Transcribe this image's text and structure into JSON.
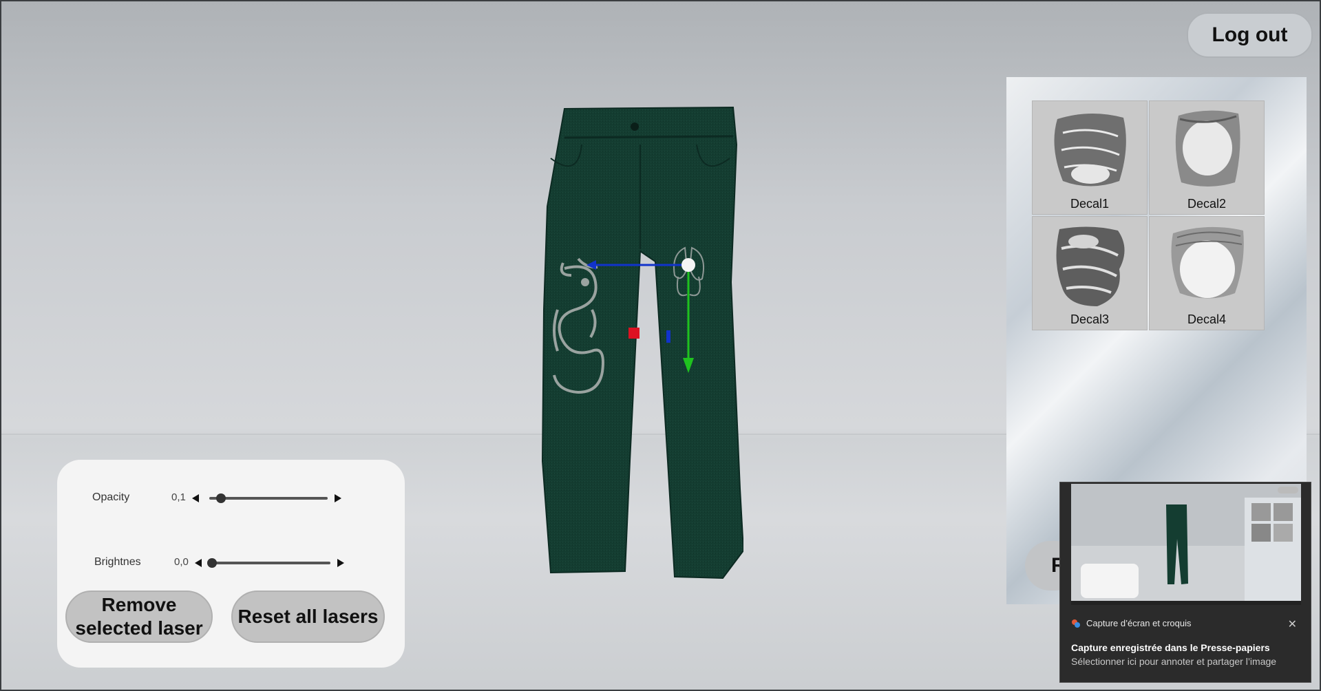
{
  "header": {
    "logout_label": "Log out"
  },
  "decals": [
    {
      "label": "Decal1"
    },
    {
      "label": "Decal2"
    },
    {
      "label": "Decal3"
    },
    {
      "label": "Decal4"
    }
  ],
  "panel": {
    "partial_button_label": "R"
  },
  "controls": {
    "opacity": {
      "label": "Opacity",
      "value": "0,1",
      "level": 0.1
    },
    "brightness": {
      "label": "Brightnes",
      "value": "0,0",
      "level": 0.0
    },
    "remove_label": "Remove selected laser",
    "reset_label": "Reset all lasers"
  },
  "notification": {
    "app_name": "Capture d’écran et croquis",
    "title": "Capture enregistrée dans le Presse-papiers",
    "body": "Sélectionner ici pour annoter et partager l’image",
    "close_glyph": "✕"
  },
  "colors": {
    "pants": "#143d31",
    "gizmo_x": "#1133cc",
    "gizmo_y": "#1fc21f",
    "gizmo_marker": "#dd1122"
  }
}
